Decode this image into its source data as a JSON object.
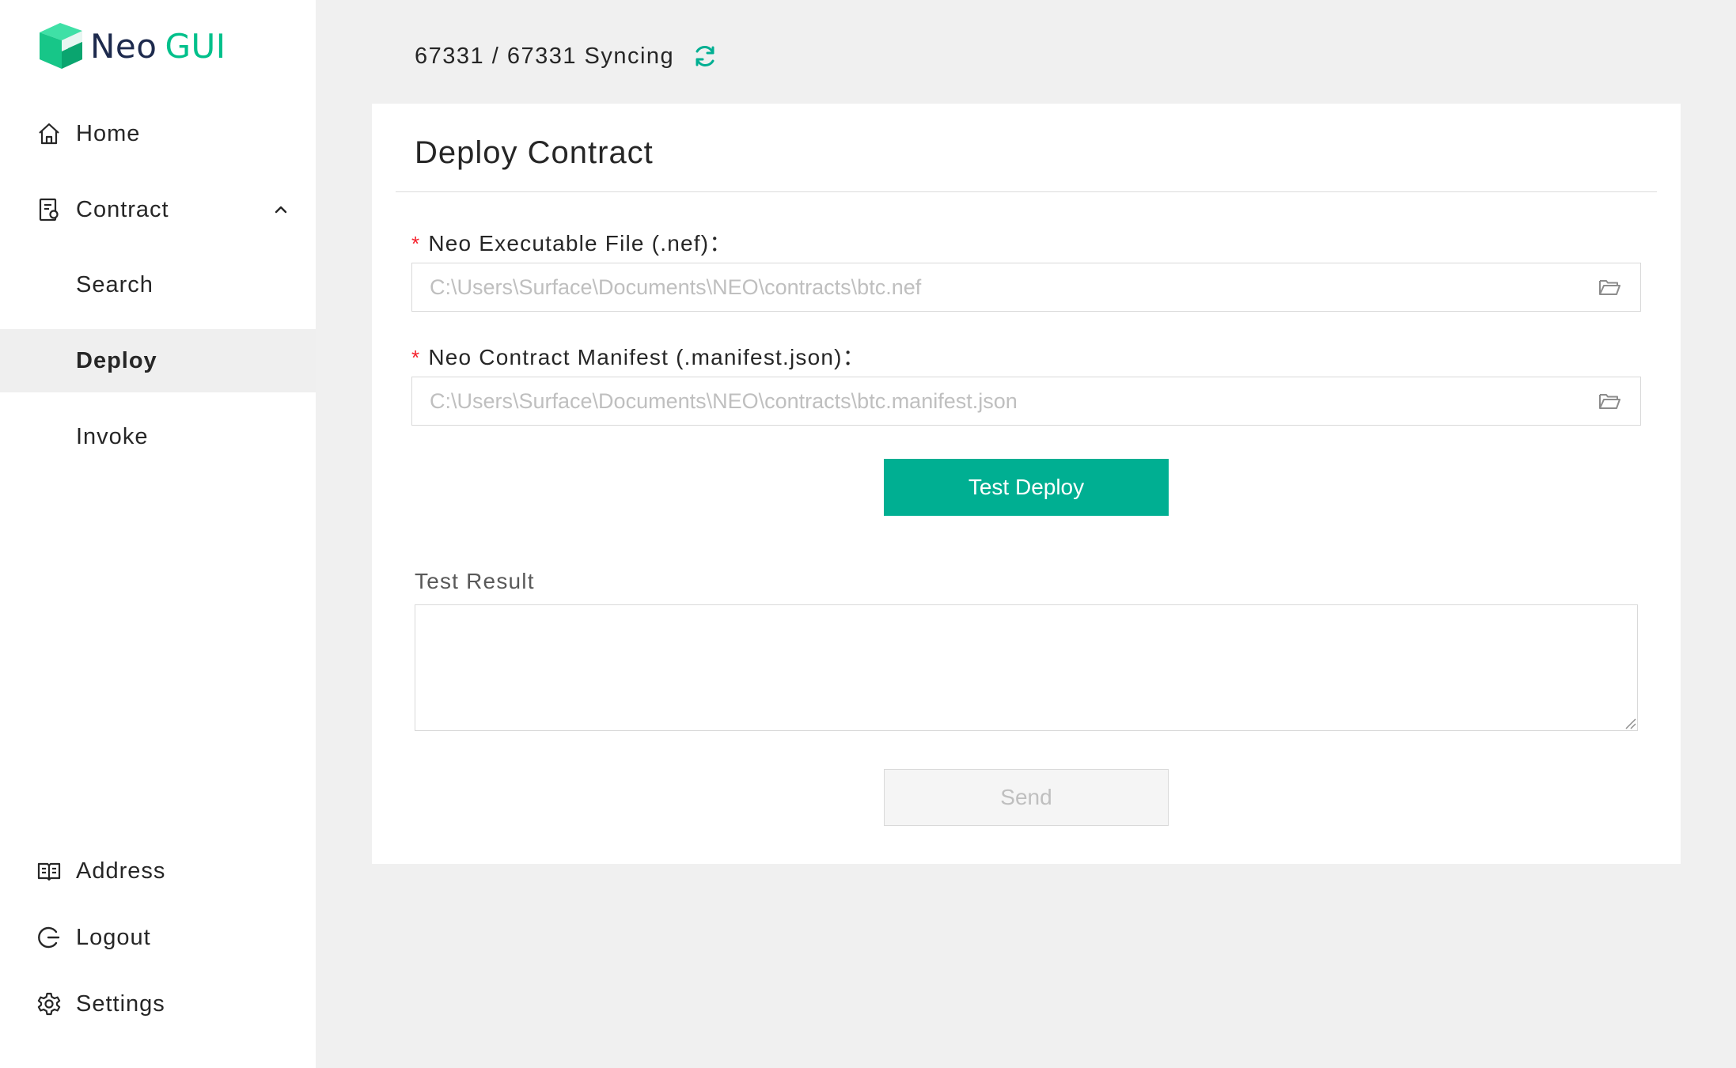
{
  "app": {
    "logo_primary": "Neo",
    "logo_secondary": "GUI",
    "accent_color": "#00af92"
  },
  "sidebar": {
    "items": [
      {
        "label": "Home",
        "icon": "home-icon"
      },
      {
        "label": "Contract",
        "icon": "contract-icon",
        "expanded": true
      },
      {
        "label": "Search",
        "sub": true
      },
      {
        "label": "Deploy",
        "sub": true,
        "active": true
      },
      {
        "label": "Invoke",
        "sub": true
      },
      {
        "label": "Address",
        "icon": "address-book-icon"
      },
      {
        "label": "Logout",
        "icon": "logout-icon"
      },
      {
        "label": "Settings",
        "icon": "gear-icon"
      }
    ]
  },
  "status": {
    "sync_text": "67331 / 67331 Syncing"
  },
  "deploy": {
    "title": "Deploy Contract",
    "nef_label": "Neo Executable File (.nef)：",
    "nef_placeholder": "C:\\Users\\Surface\\Documents\\NEO\\contracts\\btc.nef",
    "manifest_label": "Neo Contract Manifest (.manifest.json)：",
    "manifest_placeholder": "C:\\Users\\Surface\\Documents\\NEO\\contracts\\btc.manifest.json",
    "required_mark": "*",
    "test_deploy_label": "Test Deploy",
    "result_label": "Test Result",
    "result_value": "",
    "send_label": "Send"
  }
}
